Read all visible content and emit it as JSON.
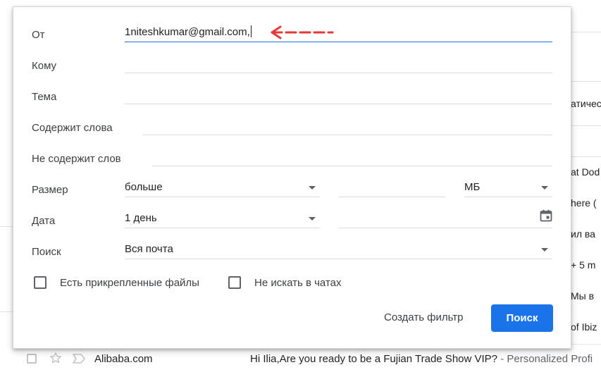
{
  "background": {
    "snippets": [
      "атичес",
      "at Dod",
      "here (",
      "ил ва",
      "+ 5 m",
      "Мы в",
      "of Ibiz"
    ],
    "email_row": {
      "sender": "Alibaba.com",
      "subject": "Hi Ilia,Are you ready to be a Fujian Trade Show VIP?",
      "snippet": " - Personalized Profi"
    }
  },
  "search_dialog": {
    "from": {
      "label": "От",
      "value": "1niteshkumar@gmail.com,"
    },
    "to": {
      "label": "Кому",
      "value": ""
    },
    "subject": {
      "label": "Тема",
      "value": ""
    },
    "has_words": {
      "label": "Содержит слова",
      "value": ""
    },
    "doesnt_have": {
      "label": "Не содержит слов",
      "value": ""
    },
    "size": {
      "label": "Размер",
      "operator": "больше",
      "value": "",
      "unit": "МБ"
    },
    "date": {
      "label": "Дата",
      "range": "1 день",
      "value": ""
    },
    "search_in": {
      "label": "Поиск",
      "value": "Вся почта"
    },
    "has_attachment": {
      "label": "Есть прикрепленные файлы",
      "checked": false
    },
    "exclude_chats": {
      "label": "Не искать в чатах",
      "checked": false
    },
    "create_filter_label": "Создать фильтр",
    "search_button_label": "Поиск"
  },
  "colors": {
    "primary": "#1a73e8",
    "annotation_arrow": "#e53935",
    "field_underline": "#dadce0"
  }
}
